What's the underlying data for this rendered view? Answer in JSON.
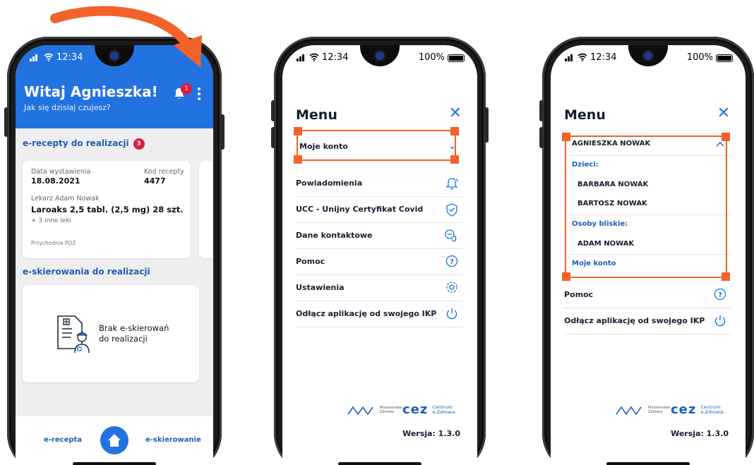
{
  "phone1": {
    "status_time": "12:34",
    "greeting": "Witaj Agnieszka!",
    "subtitle": "Jak się dzisiaj czujesz?",
    "notification_count": "1",
    "prescriptions_title": "e-recepty do realizacji",
    "prescriptions_count": "3",
    "card": {
      "issue_label": "Data wystawienia",
      "issue_date": "18.08.2021",
      "code_label": "Kod recepty",
      "code_value": "4477",
      "doctor": "Lekarz Adam Nowak",
      "drug": "Laroaks 2,5 tabl. (2,5 mg) 28 szt.",
      "more": "+ 3 inne leki",
      "clinic": "Przychodnia POZ"
    },
    "referrals_title": "e-skierowania do realizacji",
    "referrals_empty_line1": "Brak e-skierowań",
    "referrals_empty_line2": "do realizacji",
    "nav_left": "e-recepta",
    "nav_right": "e-skierowanie"
  },
  "phone2": {
    "status_time": "12:34",
    "battery": "100%",
    "menu_title": "Menu",
    "close": "✕",
    "account": "Moje konto",
    "items": [
      "Powiadomienia",
      "UCC - Unijny Certyfikat Covid",
      "Dane kontaktowe",
      "Pomoc",
      "Ustawienia",
      "Odłącz aplikację od swojego IKP"
    ],
    "ministry": "Ministerstwo Zdrowia",
    "cez": "cez",
    "cez_sub": "Centrum e-Zdrowia",
    "version": "Wersja: 1.3.0"
  },
  "phone3": {
    "status_time": "12:34",
    "battery": "100%",
    "menu_title": "Menu",
    "close": "✕",
    "owner": "AGNIESZKA NOWAK",
    "children_label": "Dzieci:",
    "children": [
      "BARBARA NOWAK",
      "BARTOSZ NOWAK"
    ],
    "relatives_label": "Osoby bliskie:",
    "relatives": [
      "ADAM NOWAK"
    ],
    "my_account": "Moje konto",
    "items": [
      "Pomoc",
      "Odłącz aplikację od swojego IKP"
    ],
    "ministry": "Ministerstwo Zdrowia",
    "cez": "cez",
    "cez_sub": "Centrum e-Zdrowia",
    "version": "Wersja: 1.3.0"
  },
  "colors": {
    "primary": "#2273e0",
    "highlight": "#f2622a",
    "badge": "#e3183b",
    "text": "#151f2e"
  }
}
